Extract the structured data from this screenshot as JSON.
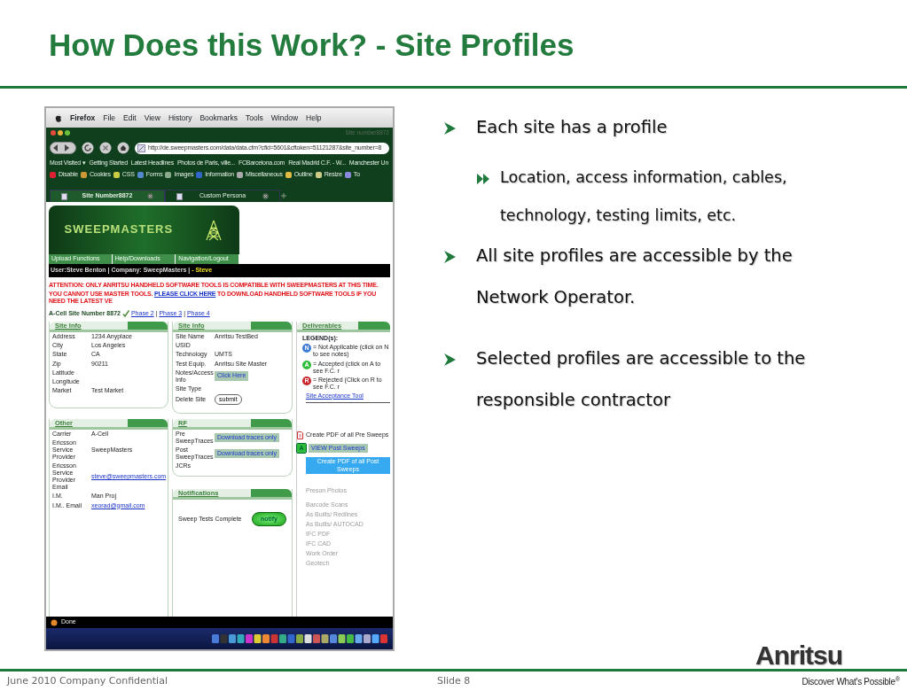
{
  "slide": {
    "title": "How Does this Work? - Site Profiles"
  },
  "screenshot": {
    "menu_bar": [
      "Firefox",
      "File",
      "Edit",
      "View",
      "History",
      "Bookmarks",
      "Tools",
      "Window",
      "Help"
    ],
    "window_title": "Site number8872",
    "address": "http://de.sweepmasters.com/data/data.cfm?cfid=5601&cftoken=51121287&site_number=8",
    "bookmarks": [
      "Most Visited ▾",
      "Getting Started",
      "Latest Headlines",
      "Photos de Paris, ville...",
      "FCBarcelona.com",
      "Real Madrid C.F. - W...",
      "Manchester Un"
    ],
    "dev_toolbar": [
      "Disable",
      "Cookies",
      "CSS",
      "Forms",
      "Images",
      "Information",
      "Miscellaneous",
      "Outline",
      "Resize",
      "To"
    ],
    "tabs": [
      {
        "label": "Site Number8872",
        "selected": true
      },
      {
        "label": "Custom Persona",
        "selected": false
      }
    ],
    "site_logo": "SWEEPMASTERS",
    "nav": [
      "Upload Functions",
      "Help/Downloads",
      "Navigation/Logout"
    ],
    "user_bar": {
      "text": "User:Steve Benton | Company: SweepMasters | ",
      "name": "- Steve"
    },
    "attention": {
      "line1": "ATTENTION: ONLY ANRITSU HANDHELD SOFTWARE TOOLS IS COMPATIBLE WITH SWEEPMASTERS AT THIS TIME.",
      "before": "YOU CANNOT USE MASTER TOOLS. ",
      "link": "PLEASE CLICK HERE",
      "after": " TO DOWNLOAD HANDHELD SOFTWARE TOOLS IF YOU NEED THE LATEST VE"
    },
    "site_heading": "A-Cell Site Number 8872",
    "separator": "|",
    "phases": [
      "Phase 2",
      "Phase 3",
      "Phase 4"
    ],
    "panels": [
      {
        "title": "Site Info",
        "rows": [
          {
            "label": "Address",
            "value": "1234 Anyplace",
            "kind": "text"
          },
          {
            "label": "City",
            "value": "Los Angeles",
            "kind": "text"
          },
          {
            "label": "State",
            "value": "CA",
            "kind": "text"
          },
          {
            "label": "Zip",
            "value": "90211",
            "kind": "text"
          },
          {
            "label": "Latitude"
          },
          {
            "label": "Longitude"
          },
          {
            "label": "Market",
            "value": "Test Market",
            "kind": "text"
          }
        ]
      },
      {
        "title": "Site Info",
        "rows": [
          {
            "label": "Site Name",
            "value": "Anritsu TestBed",
            "kind": "text"
          },
          {
            "label": "USID"
          },
          {
            "label": "Technology",
            "value": "UMTS",
            "kind": "text"
          },
          {
            "label": "Test Equip.",
            "value": "Anritsu Site Master",
            "kind": "text"
          },
          {
            "label": "Notes/Access Info",
            "value": "Click Here",
            "kind": "button"
          },
          {
            "label": "Site Type"
          },
          {
            "label": "Delete Site",
            "value": "submit",
            "kind": "pill"
          }
        ]
      },
      {
        "title": "Other",
        "rows": [
          {
            "label": "Carrier",
            "value": "A-Cell",
            "kind": "text"
          },
          {
            "label": "Ericsson Service Provider",
            "value": "SweepMasters",
            "kind": "text"
          },
          {
            "label": "Ericsson Service Provider Email",
            "value": "steve@sweepmasters.com",
            "kind": "link"
          },
          {
            "label": "I.M.",
            "value": "Man Proj",
            "kind": "text"
          },
          {
            "label": "I.M.. Email",
            "value": "xeorad@gmail.com",
            "kind": "link"
          }
        ]
      },
      {
        "title": "RF",
        "rows": [
          {
            "label": "Pre SweepTraces",
            "value": "Download traces only",
            "kind": "button"
          },
          {
            "label": "Post SweepTraces",
            "value": "Download traces only",
            "kind": "button"
          },
          {
            "label": "JCRs"
          }
        ]
      },
      {
        "title": "Notifications",
        "rows": [
          {
            "label": "Sweep Tests Complete",
            "value": "notify",
            "kind": "notify"
          }
        ]
      }
    ],
    "deliverables": {
      "title": "Deliverables",
      "legend_title": "LEGEND(s):",
      "legend": [
        {
          "letter": "N",
          "text": "= Not Applicable (click on N to see notes)",
          "color": "#3b7bd8"
        },
        {
          "letter": "A",
          "text": "= Accepted (click on A to see F.C. r",
          "color": "#2ebd3a"
        },
        {
          "letter": "R",
          "text": "= Rejected (Click on R to see F.C. r",
          "color": "#c8262c"
        }
      ],
      "tool_link": "Site Acceptance Tool",
      "actions": [
        {
          "kind": "pdf",
          "text": "Create PDF of all Pre Sweeps"
        },
        {
          "kind": "view",
          "icon": "A",
          "text": "VIEW Post Sweeps"
        },
        {
          "kind": "blue",
          "text": "Create PDF of all Post Sweeps"
        }
      ],
      "documents": [
        {
          "text": "Preson Photos",
          "disabled": true
        },
        {
          "text": "Barcode Scans",
          "disabled": true
        },
        {
          "text": "As Builts/ Redlines",
          "disabled": true
        },
        {
          "text": "As Builts/ AUTOCAD",
          "disabled": true
        },
        {
          "text": "IFC PDF",
          "disabled": true
        },
        {
          "text": "IFC CAD",
          "disabled": true
        },
        {
          "text": "Work Order",
          "disabled": true
        },
        {
          "text": "Geotech",
          "disabled": true
        }
      ]
    },
    "status": "Done"
  },
  "bullets": [
    {
      "text": "Each site has a profile",
      "children": [
        {
          "text": "Location, access information, cables, technology, testing limits, etc."
        }
      ]
    },
    {
      "text": "All site profiles are accessible by the Network Operator."
    },
    {
      "text": "Selected profiles are accessible to the responsible contractor"
    }
  ],
  "logo": {
    "name": "Anritsu",
    "tagline": "Discover What's Possible$^{®}$"
  },
  "footer": {
    "left": "June 2010 Company Confidential",
    "center": "Slide 8"
  }
}
